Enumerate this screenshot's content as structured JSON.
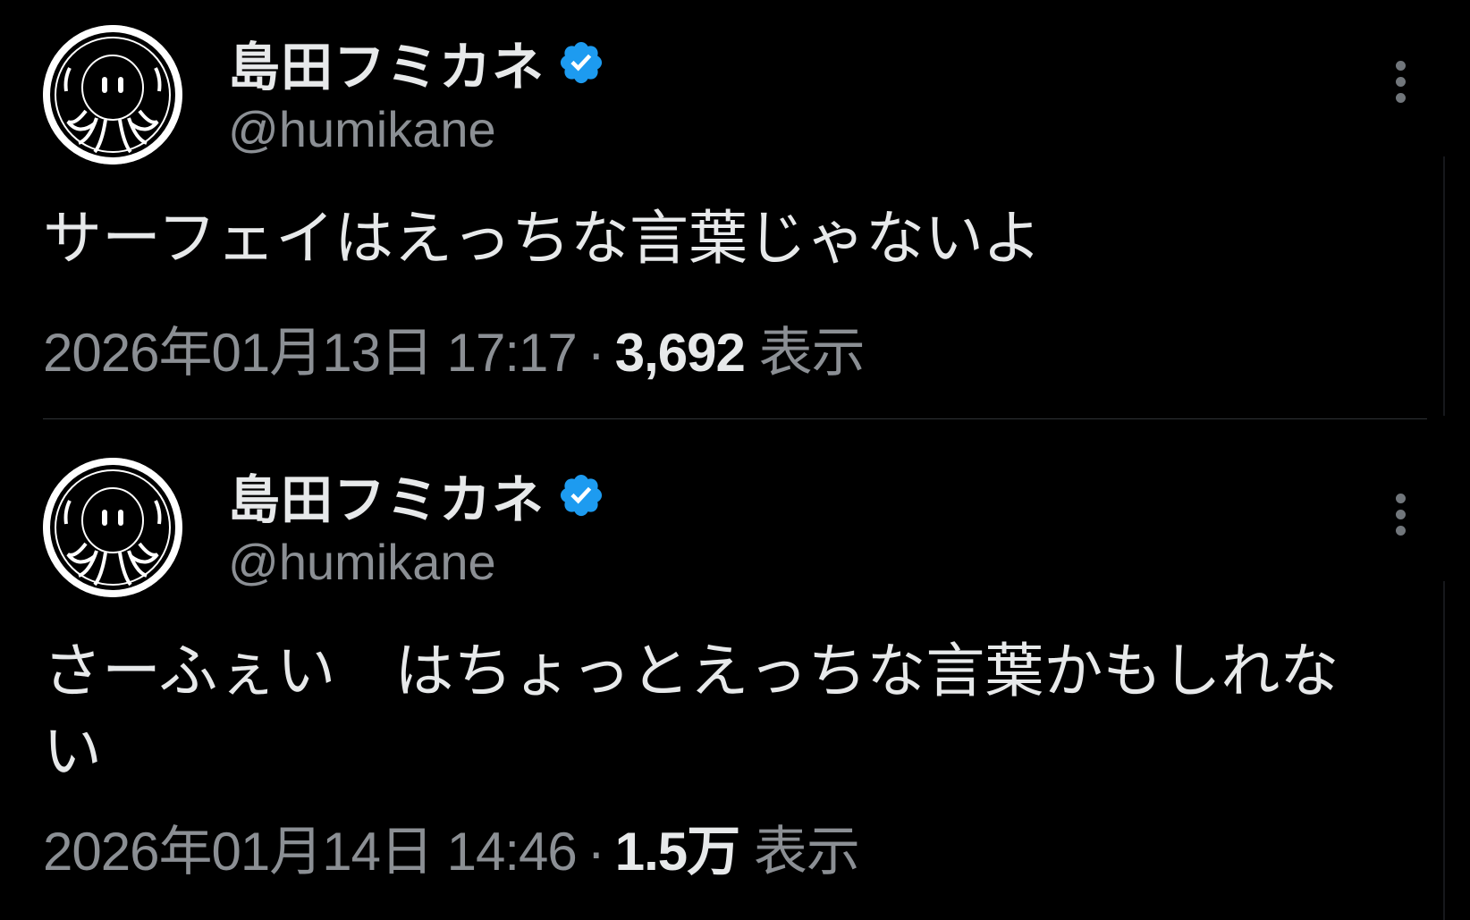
{
  "colors": {
    "background": "#000000",
    "primary_text": "#e7e9ea",
    "secondary_text": "#8b8f94",
    "verified_badge": "#1d9bf0",
    "divider": "#2f3336"
  },
  "tweets": [
    {
      "display_name": "島田フミカネ",
      "handle": "@humikane",
      "verified_icon": "verified-badge-icon",
      "more_icon": "more-vertical-icon",
      "text": "サーフェイはえっちな言葉じゃないよ",
      "timestamp": "2026年01月13日 17:17",
      "separator": "·",
      "views": "3,692",
      "views_label": "表示"
    },
    {
      "display_name": "島田フミカネ",
      "handle": "@humikane",
      "verified_icon": "verified-badge-icon",
      "more_icon": "more-vertical-icon",
      "text": "さーふぇい　はちょっとえっちな言葉かもしれない",
      "timestamp": "2026年01月14日 14:46",
      "separator": "·",
      "views": "1.5万",
      "views_label": "表示"
    }
  ]
}
